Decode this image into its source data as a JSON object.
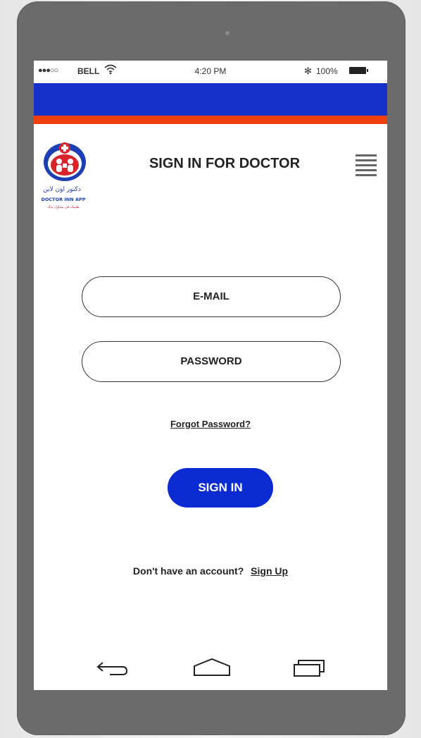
{
  "status_bar": {
    "signal": "●●●○○",
    "carrier": "BELL",
    "time": "4:20 PM",
    "bluetooth": "✻",
    "battery": "100%"
  },
  "colors": {
    "header_blue": "#1432c8",
    "header_red": "#ee3f0f",
    "button_blue": "#0b2bd2"
  },
  "header": {
    "title": "SIGN IN FOR DOCTOR",
    "logo_line1": "دكتور اون لاين",
    "logo_line2": "DOCTOR INN APP",
    "logo_line3": "طبيبك في متناول يدك"
  },
  "form": {
    "email_label": "E-MAIL",
    "password_label": "PASSWORD",
    "forgot_password": "Forgot Password?",
    "sign_in": "SIGN IN"
  },
  "footer": {
    "no_account_text": "Don't have an account?",
    "sign_up": "Sign Up"
  },
  "icons": {
    "menu": "hamburger-menu-icon",
    "back": "back-arrow-icon",
    "home": "home-icon",
    "recent": "recent-apps-icon"
  }
}
